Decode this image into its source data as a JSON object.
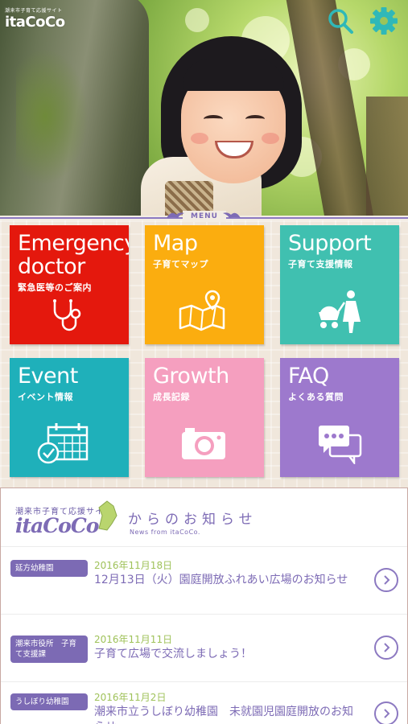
{
  "header": {
    "logo_tag": "潮来市子育て応援サイト",
    "logo_name": "itaCoCo",
    "search_icon": "search-icon",
    "settings_icon": "gear-icon"
  },
  "menu": {
    "label": "MENU",
    "tiles": [
      {
        "title_line1": "Emergency",
        "title_line2": "doctor",
        "subtitle": "緊急医等のご案内",
        "icon": "stethoscope-icon",
        "color": "#e4180d"
      },
      {
        "title_line1": "Map",
        "subtitle": "子育てマップ",
        "icon": "map-icon",
        "color": "#fbad0f"
      },
      {
        "title_line1": "Support",
        "subtitle": "子育て支援情報",
        "icon": "stroller-icon",
        "color": "#40c0b0"
      },
      {
        "title_line1": "Event",
        "subtitle": "イベント情報",
        "icon": "calendar-icon",
        "color": "#1fb0ba"
      },
      {
        "title_line1": "Growth",
        "subtitle": "成長記録",
        "icon": "camera-icon",
        "color": "#f59fbf"
      },
      {
        "title_line1": "FAQ",
        "subtitle": "よくある質問",
        "icon": "chat-icon",
        "color": "#9d79cd"
      }
    ]
  },
  "news": {
    "brand_tag": "潮来市子育て応援サイト",
    "brand_name": "itaCoCo",
    "from_title": "からのお知らせ",
    "from_sub": "News from itaCoCo.",
    "items": [
      {
        "org": "延方幼稚園",
        "date": "2016年11月18日",
        "title": "12月13日（火）園庭開放ふれあい広場のお知らせ"
      },
      {
        "org": "潮来市役所　子育て支援課",
        "date": "2016年11月11日",
        "title": "子育て広場で交流しましょう！"
      },
      {
        "org": "うしぼり幼稚園",
        "date": "2016年11月2日",
        "title": "潮来市立うしぼり幼稚園　未就園児園庭開放のお知らせ"
      }
    ]
  },
  "colors": {
    "accent_purple": "#7d6bb5",
    "date_green": "#9fc25a"
  }
}
